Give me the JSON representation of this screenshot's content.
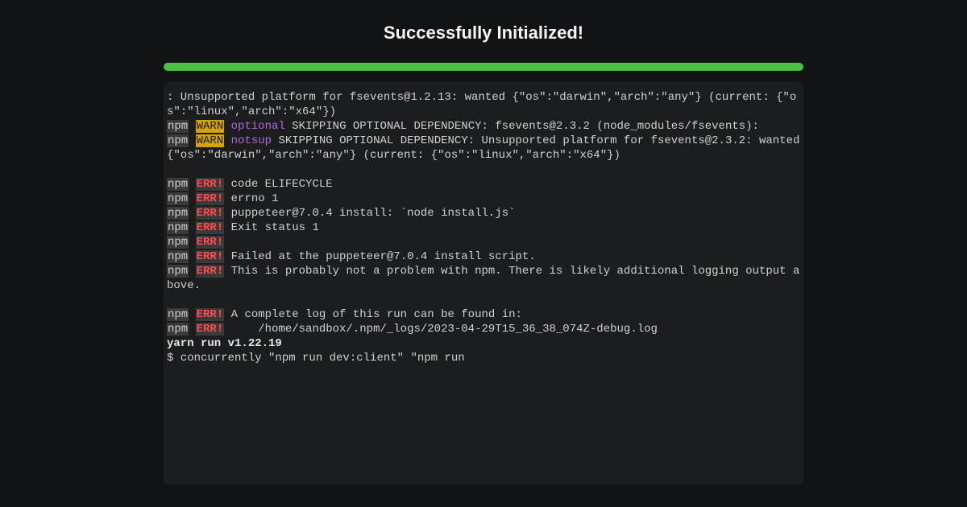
{
  "title": "Successfully Initialized!",
  "progress": {
    "percent": 100,
    "color": "#4ac24a"
  },
  "terminal": {
    "lines": [
      [
        {
          "t": ": Unsupported platform for fsevents@1.2.13: wanted {\"os\":\"darwin\",\"arch\":\"any\"} (current: {\"os\":\"linux\",\"arch\":\"x64\"})"
        }
      ],
      [
        {
          "t": "npm",
          "c": "npm-badge"
        },
        {
          "t": " "
        },
        {
          "t": "WARN",
          "c": "warn-badge"
        },
        {
          "t": " "
        },
        {
          "t": "optional",
          "c": "optional"
        },
        {
          "t": " SKIPPING OPTIONAL DEPENDENCY: fsevents@2.3.2 (node_modules/fsevents):"
        }
      ],
      [
        {
          "t": "npm",
          "c": "npm-badge"
        },
        {
          "t": " "
        },
        {
          "t": "WARN",
          "c": "warn-badge"
        },
        {
          "t": " "
        },
        {
          "t": "notsup",
          "c": "optional"
        },
        {
          "t": " SKIPPING OPTIONAL DEPENDENCY: Unsupported platform for fsevents@2.3.2: wanted {\"os\":\"darwin\",\"arch\":\"any\"} (current: {\"os\":\"linux\",\"arch\":\"x64\"})"
        }
      ],
      [
        {
          "t": " "
        }
      ],
      [
        {
          "t": "npm",
          "c": "npm-badge"
        },
        {
          "t": " "
        },
        {
          "t": "ERR!",
          "c": "err-badge"
        },
        {
          "t": " code ELIFECYCLE"
        }
      ],
      [
        {
          "t": "npm",
          "c": "npm-badge"
        },
        {
          "t": " "
        },
        {
          "t": "ERR!",
          "c": "err-badge"
        },
        {
          "t": " errno 1"
        }
      ],
      [
        {
          "t": "npm",
          "c": "npm-badge"
        },
        {
          "t": " "
        },
        {
          "t": "ERR!",
          "c": "err-badge"
        },
        {
          "t": " puppeteer@7.0.4 install: `node install.js`"
        }
      ],
      [
        {
          "t": "npm",
          "c": "npm-badge"
        },
        {
          "t": " "
        },
        {
          "t": "ERR!",
          "c": "err-badge"
        },
        {
          "t": " Exit status 1"
        }
      ],
      [
        {
          "t": "npm",
          "c": "npm-badge"
        },
        {
          "t": " "
        },
        {
          "t": "ERR!",
          "c": "err-badge"
        },
        {
          "t": " "
        }
      ],
      [
        {
          "t": "npm",
          "c": "npm-badge"
        },
        {
          "t": " "
        },
        {
          "t": "ERR!",
          "c": "err-badge"
        },
        {
          "t": " Failed at the puppeteer@7.0.4 install script."
        }
      ],
      [
        {
          "t": "npm",
          "c": "npm-badge"
        },
        {
          "t": " "
        },
        {
          "t": "ERR!",
          "c": "err-badge"
        },
        {
          "t": " This is probably not a problem with npm. There is likely additional logging output above."
        }
      ],
      [
        {
          "t": " "
        }
      ],
      [
        {
          "t": "npm",
          "c": "npm-badge"
        },
        {
          "t": " "
        },
        {
          "t": "ERR!",
          "c": "err-badge"
        },
        {
          "t": " A complete log of this run can be found in:"
        }
      ],
      [
        {
          "t": "npm",
          "c": "npm-badge"
        },
        {
          "t": " "
        },
        {
          "t": "ERR!",
          "c": "err-badge"
        },
        {
          "t": "     /home/sandbox/.npm/_logs/2023-04-29T15_36_38_074Z-debug.log"
        }
      ],
      [
        {
          "t": "yarn run v1.22.19",
          "c": "bold"
        }
      ],
      [
        {
          "t": "$ concurrently \"npm run dev:client\" \"npm run"
        }
      ]
    ]
  }
}
